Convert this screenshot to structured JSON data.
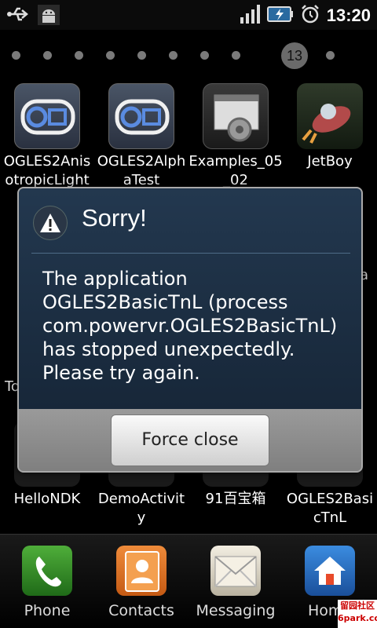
{
  "status_bar": {
    "time": "13:20"
  },
  "pager": {
    "current_page": "13"
  },
  "apps": [
    {
      "label": "OGLES2AnisotropicLight",
      "icon": "ogles-icon"
    },
    {
      "label": "OGLES2AlphaTest",
      "icon": "ogles-icon"
    },
    {
      "label": "Examples_05_02",
      "icon": "examples-icon"
    },
    {
      "label": "JetBoy",
      "icon": "jetboy-icon"
    },
    {
      "label": "HelloNDK",
      "icon": "app-icon"
    },
    {
      "label": "DemoActivity",
      "icon": "app-icon"
    },
    {
      "label": "91百宝箱",
      "icon": "app-icon"
    },
    {
      "label": "OGLES2BasicTnL",
      "icon": "app-icon"
    }
  ],
  "side_labels": {
    "left": "To",
    "right": "a"
  },
  "dock": [
    {
      "label": "Phone",
      "icon": "phone-icon"
    },
    {
      "label": "Contacts",
      "icon": "contacts-icon"
    },
    {
      "label": "Messaging",
      "icon": "messaging-icon"
    },
    {
      "label": "Home",
      "icon": "home-icon"
    }
  ],
  "dialog": {
    "title": "Sorry!",
    "message": "The application OGLES2BasicTnL (process com.powervr.OGLES2BasicTnL) has stopped unexpectedly. Please try again.",
    "button": "Force close"
  },
  "watermark": {
    "line1": "留园社区",
    "line2": "6park.com"
  }
}
